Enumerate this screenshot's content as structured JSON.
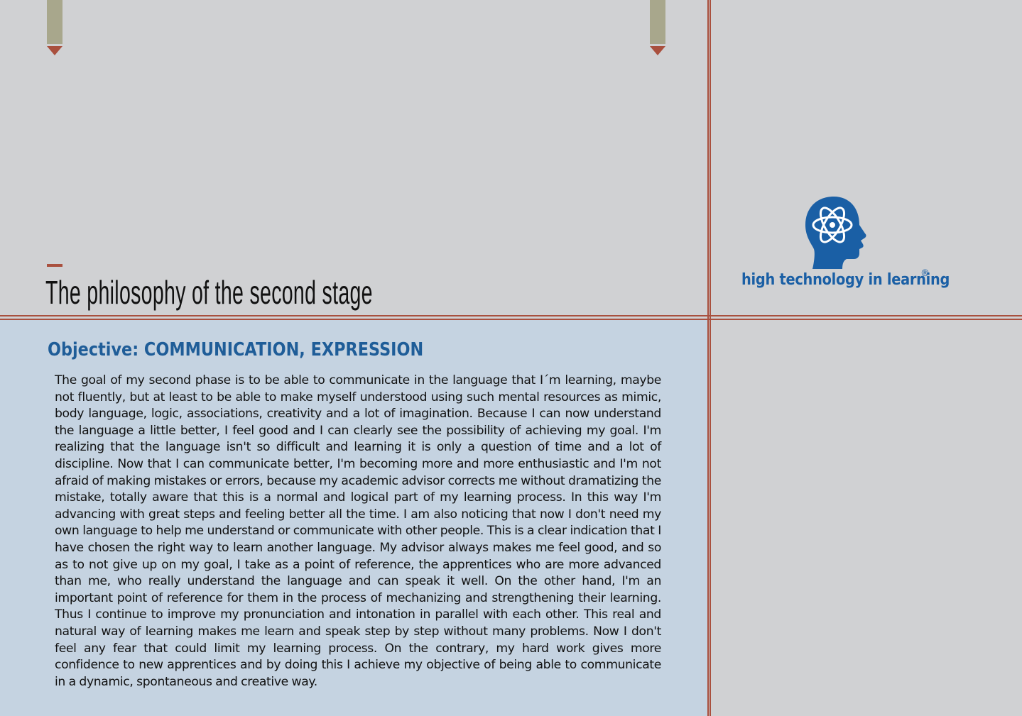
{
  "page": {
    "title": "The philosophy of the second stage",
    "section_heading": "Objective: COMMUNICATION, EXPRESSION",
    "body": "The goal of my second phase is to be able to communicate in the language that I´m learning, maybe not fluently, but at least to be able to make myself understood using such mental resources as mimic, body language, logic, associations, creativity and a lot of imagination. Because I can now understand the language a little better, I feel good and I can clearly see the possibility of achieving my goal. I'm realizing that the language isn't so difficult and learning it is only a question of time and a lot of discipline. Now that I can communicate better, I'm becoming more and more enthusiastic and I'm not afraid of making mistakes or errors, because my academic advisor corrects me without dramatizing the mistake, totally aware that this is a normal and logical part of my learning process. In this way I'm advancing with great steps and feeling better all the time. I am also noticing that now I don't need my own language to help me understand or communicate with other people. This is a clear indication that I have chosen the right way to learn another language. My advisor always makes me feel good, and so as to not give up on my goal, I take as a point of reference, the apprentices who are more advanced than me, who really understand the language and can speak it well. On the other hand, I'm an important point of reference for them in the process of mechanizing and strengthening their learning. Thus I continue to improve my pronunciation and intonation in parallel with each other. This real and natural way of learning makes me learn and speak step by step without many problems. Now I don't feel any fear that could limit my learning process. On the contrary, my hard work gives more confidence to new apprentices and by doing this I achieve my objective of being able to communicate in a dynamic, spontaneous and creative way."
  },
  "logo": {
    "icon": "head-atom-icon",
    "text": "high technology in learning",
    "registered": "®"
  },
  "colors": {
    "accent_red": "#a9503e",
    "heading_blue": "#1f5d98",
    "logo_blue": "#1a5fa5",
    "panel_gray": "#d0d1d3",
    "panel_blue": "#c5d3e1",
    "tab_olive": "#a8a78c"
  }
}
